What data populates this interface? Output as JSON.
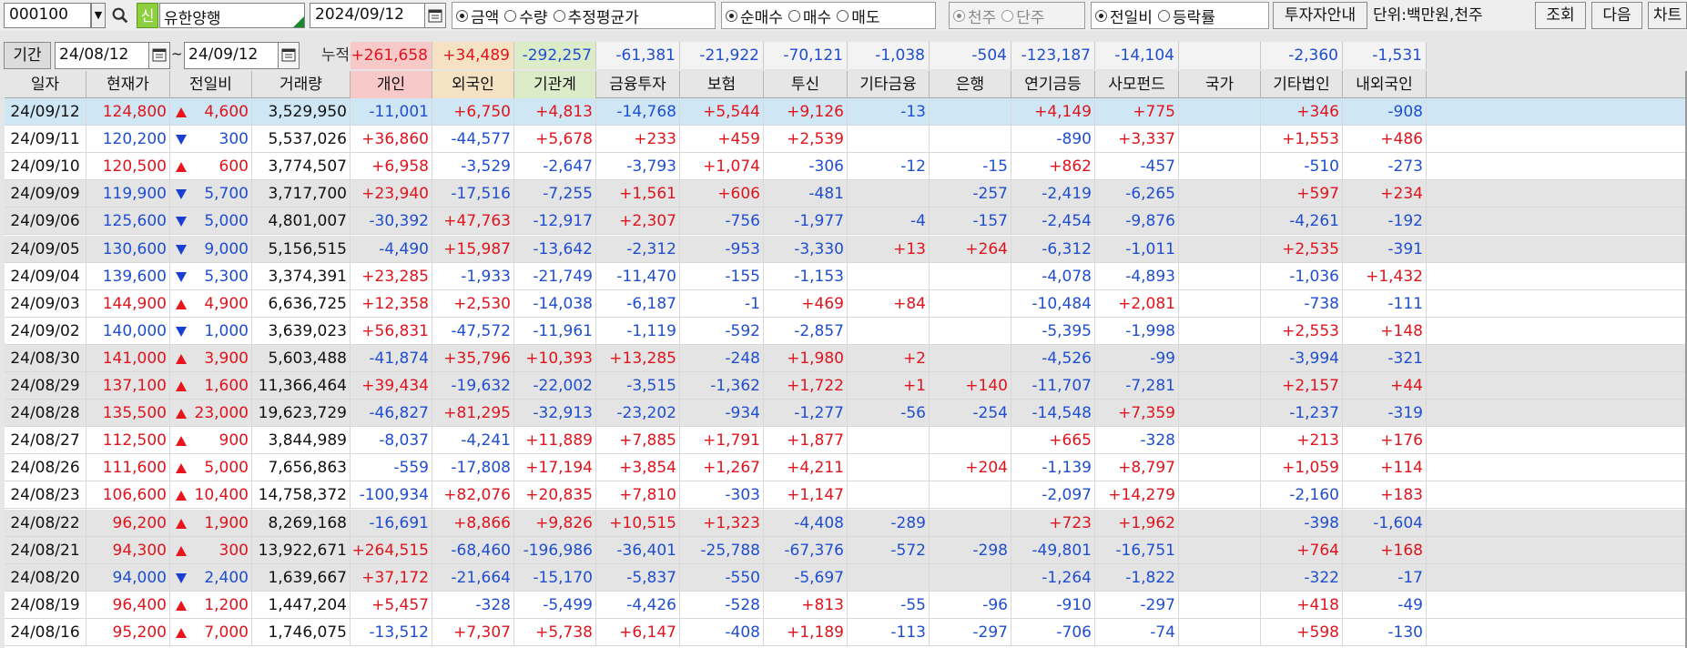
{
  "toolbar": {
    "code": "000100",
    "name_badge": "신",
    "name": "유한양행",
    "date": "2024/09/12",
    "group_value": {
      "options": [
        "금액",
        "수량",
        "추정평균가"
      ],
      "selected": 0
    },
    "group_trade": {
      "options": [
        "순매수",
        "매수",
        "매도"
      ],
      "selected": 0
    },
    "group_unit": {
      "options": [
        "천주",
        "단주"
      ],
      "selected": 0
    },
    "group_compare": {
      "options": [
        "전일비",
        "등락률"
      ],
      "selected": 0
    },
    "investor_info_button": "투자자안내",
    "unit_text": "단위:백만원,천주",
    "search_button": "조회",
    "next_button": "다음",
    "chart_button": "차트"
  },
  "period": {
    "label": "기간",
    "from": "24/08/12",
    "tilde": "~",
    "to": "24/09/12",
    "cumulative_label": "누적순매수",
    "sums": [
      "+261,658",
      "+34,489",
      "-292,257",
      "-61,381",
      "-21,922",
      "-70,121",
      "-1,038",
      "-504",
      "-123,187",
      "-14,104",
      "",
      "-2,360",
      "-1,531"
    ]
  },
  "grid": {
    "headers": [
      "일자",
      "현재가",
      "전일비",
      "거래량",
      "개인",
      "외국인",
      "기관계",
      "금융투자",
      "보험",
      "투신",
      "기타금융",
      "은행",
      "연기금등",
      "사모펀드",
      "국가",
      "기타법인",
      "내외국인"
    ],
    "rows": [
      {
        "date": "24/09/12",
        "price": "124,800",
        "dir": "up",
        "chg": "4,600",
        "vol": "3,529,950",
        "vals": [
          "-11,001",
          "+6,750",
          "+4,813",
          "-14,768",
          "+5,544",
          "+9,126",
          "-13",
          "",
          "+4,149",
          "+775",
          "",
          "+346",
          "-908"
        ],
        "shade": "sel"
      },
      {
        "date": "24/09/11",
        "price": "120,200",
        "dir": "down",
        "chg": "300",
        "vol": "5,537,026",
        "vals": [
          "+36,860",
          "-44,577",
          "+5,678",
          "+233",
          "+459",
          "+2,539",
          "",
          "",
          "-890",
          "+3,337",
          "",
          "+1,553",
          "+486"
        ],
        "shade": "white"
      },
      {
        "date": "24/09/10",
        "price": "120,500",
        "dir": "up",
        "chg": "600",
        "vol": "3,774,507",
        "vals": [
          "+6,958",
          "-3,529",
          "-2,647",
          "-3,793",
          "+1,074",
          "-306",
          "-12",
          "-15",
          "+862",
          "-457",
          "",
          "-510",
          "-273"
        ],
        "shade": "white"
      },
      {
        "date": "24/09/09",
        "price": "119,900",
        "dir": "down",
        "chg": "5,700",
        "vol": "3,717,700",
        "vals": [
          "+23,940",
          "-17,516",
          "-7,255",
          "+1,561",
          "+606",
          "-481",
          "",
          "-257",
          "-2,419",
          "-6,265",
          "",
          "+597",
          "+234"
        ],
        "shade": "gray"
      },
      {
        "date": "24/09/06",
        "price": "125,600",
        "dir": "down",
        "chg": "5,000",
        "vol": "4,801,007",
        "vals": [
          "-30,392",
          "+47,763",
          "-12,917",
          "+2,307",
          "-756",
          "-1,977",
          "-4",
          "-157",
          "-2,454",
          "-9,876",
          "",
          "-4,261",
          "-192"
        ],
        "shade": "gray"
      },
      {
        "date": "24/09/05",
        "price": "130,600",
        "dir": "down",
        "chg": "9,000",
        "vol": "5,156,515",
        "vals": [
          "-4,490",
          "+15,987",
          "-13,642",
          "-2,312",
          "-953",
          "-3,330",
          "+13",
          "+264",
          "-6,312",
          "-1,011",
          "",
          "+2,535",
          "-391"
        ],
        "shade": "gray"
      },
      {
        "date": "24/09/04",
        "price": "139,600",
        "dir": "down",
        "chg": "5,300",
        "vol": "3,374,391",
        "vals": [
          "+23,285",
          "-1,933",
          "-21,749",
          "-11,470",
          "-155",
          "-1,153",
          "",
          "",
          "-4,078",
          "-4,893",
          "",
          "-1,036",
          "+1,432"
        ],
        "shade": "white"
      },
      {
        "date": "24/09/03",
        "price": "144,900",
        "dir": "up",
        "chg": "4,900",
        "vol": "6,636,725",
        "vals": [
          "+12,358",
          "+2,530",
          "-14,038",
          "-6,187",
          "-1",
          "+469",
          "+84",
          "",
          "-10,484",
          "+2,081",
          "",
          "-738",
          "-111"
        ],
        "shade": "white"
      },
      {
        "date": "24/09/02",
        "price": "140,000",
        "dir": "down",
        "chg": "1,000",
        "vol": "3,639,023",
        "vals": [
          "+56,831",
          "-47,572",
          "-11,961",
          "-1,119",
          "-592",
          "-2,857",
          "",
          "",
          "-5,395",
          "-1,998",
          "",
          "+2,553",
          "+148"
        ],
        "shade": "white"
      },
      {
        "date": "24/08/30",
        "price": "141,000",
        "dir": "up",
        "chg": "3,900",
        "vol": "5,603,488",
        "vals": [
          "-41,874",
          "+35,796",
          "+10,393",
          "+13,285",
          "-248",
          "+1,980",
          "+2",
          "",
          "-4,526",
          "-99",
          "",
          "-3,994",
          "-321"
        ],
        "shade": "gray"
      },
      {
        "date": "24/08/29",
        "price": "137,100",
        "dir": "up",
        "chg": "1,600",
        "vol": "11,366,464",
        "vals": [
          "+39,434",
          "-19,632",
          "-22,002",
          "-3,515",
          "-1,362",
          "+1,722",
          "+1",
          "+140",
          "-11,707",
          "-7,281",
          "",
          "+2,157",
          "+44"
        ],
        "shade": "gray"
      },
      {
        "date": "24/08/28",
        "price": "135,500",
        "dir": "up",
        "chg": "23,000",
        "vol": "19,623,729",
        "vals": [
          "-46,827",
          "+81,295",
          "-32,913",
          "-23,202",
          "-934",
          "-1,277",
          "-56",
          "-254",
          "-14,548",
          "+7,359",
          "",
          "-1,237",
          "-319"
        ],
        "shade": "gray"
      },
      {
        "date": "24/08/27",
        "price": "112,500",
        "dir": "up",
        "chg": "900",
        "vol": "3,844,989",
        "vals": [
          "-8,037",
          "-4,241",
          "+11,889",
          "+7,885",
          "+1,791",
          "+1,877",
          "",
          "",
          "+665",
          "-328",
          "",
          "+213",
          "+176"
        ],
        "shade": "white"
      },
      {
        "date": "24/08/26",
        "price": "111,600",
        "dir": "up",
        "chg": "5,000",
        "vol": "7,656,863",
        "vals": [
          "-559",
          "-17,808",
          "+17,194",
          "+3,854",
          "+1,267",
          "+4,211",
          "",
          "+204",
          "-1,139",
          "+8,797",
          "",
          "+1,059",
          "+114"
        ],
        "shade": "white"
      },
      {
        "date": "24/08/23",
        "price": "106,600",
        "dir": "up",
        "chg": "10,400",
        "vol": "14,758,372",
        "vals": [
          "-100,934",
          "+82,076",
          "+20,835",
          "+7,810",
          "-303",
          "+1,147",
          "",
          "",
          "-2,097",
          "+14,279",
          "",
          "-2,160",
          "+183"
        ],
        "shade": "white"
      },
      {
        "date": "24/08/22",
        "price": "96,200",
        "dir": "up",
        "chg": "1,900",
        "vol": "8,269,168",
        "vals": [
          "-16,691",
          "+8,866",
          "+9,826",
          "+10,515",
          "+1,323",
          "-4,408",
          "-289",
          "",
          "+723",
          "+1,962",
          "",
          "-398",
          "-1,604"
        ],
        "shade": "gray"
      },
      {
        "date": "24/08/21",
        "price": "94,300",
        "dir": "up",
        "chg": "300",
        "vol": "13,922,671",
        "vals": [
          "+264,515",
          "-68,460",
          "-196,986",
          "-36,401",
          "-25,788",
          "-67,376",
          "-572",
          "-298",
          "-49,801",
          "-16,751",
          "",
          "+764",
          "+168"
        ],
        "shade": "gray"
      },
      {
        "date": "24/08/20",
        "price": "94,000",
        "dir": "down",
        "chg": "2,400",
        "vol": "1,639,667",
        "vals": [
          "+37,172",
          "-21,664",
          "-15,170",
          "-5,837",
          "-550",
          "-5,697",
          "",
          "",
          "-1,264",
          "-1,822",
          "",
          "-322",
          "-17"
        ],
        "shade": "gray"
      },
      {
        "date": "24/08/19",
        "price": "96,400",
        "dir": "up",
        "chg": "1,200",
        "vol": "1,447,204",
        "vals": [
          "+5,457",
          "-328",
          "-5,499",
          "-4,426",
          "-528",
          "+813",
          "-55",
          "-96",
          "-910",
          "-297",
          "",
          "+418",
          "-49"
        ],
        "shade": "white"
      },
      {
        "date": "24/08/16",
        "price": "95,200",
        "dir": "up",
        "chg": "7,000",
        "vol": "1,746,075",
        "vals": [
          "-13,512",
          "+7,307",
          "+5,738",
          "+6,147",
          "-408",
          "+1,189",
          "-113",
          "-297",
          "-706",
          "-74",
          "",
          "+598",
          "-130"
        ],
        "shade": "white"
      }
    ]
  },
  "colors": {
    "up": "#e0141c",
    "down": "#1f4ed0",
    "header_personal": "#f8c9c9",
    "header_foreign": "#f4e2c2",
    "header_inst": "#dcecc8",
    "selected_row": "#cfe7f5",
    "gray_row": "#e4e4e4"
  }
}
